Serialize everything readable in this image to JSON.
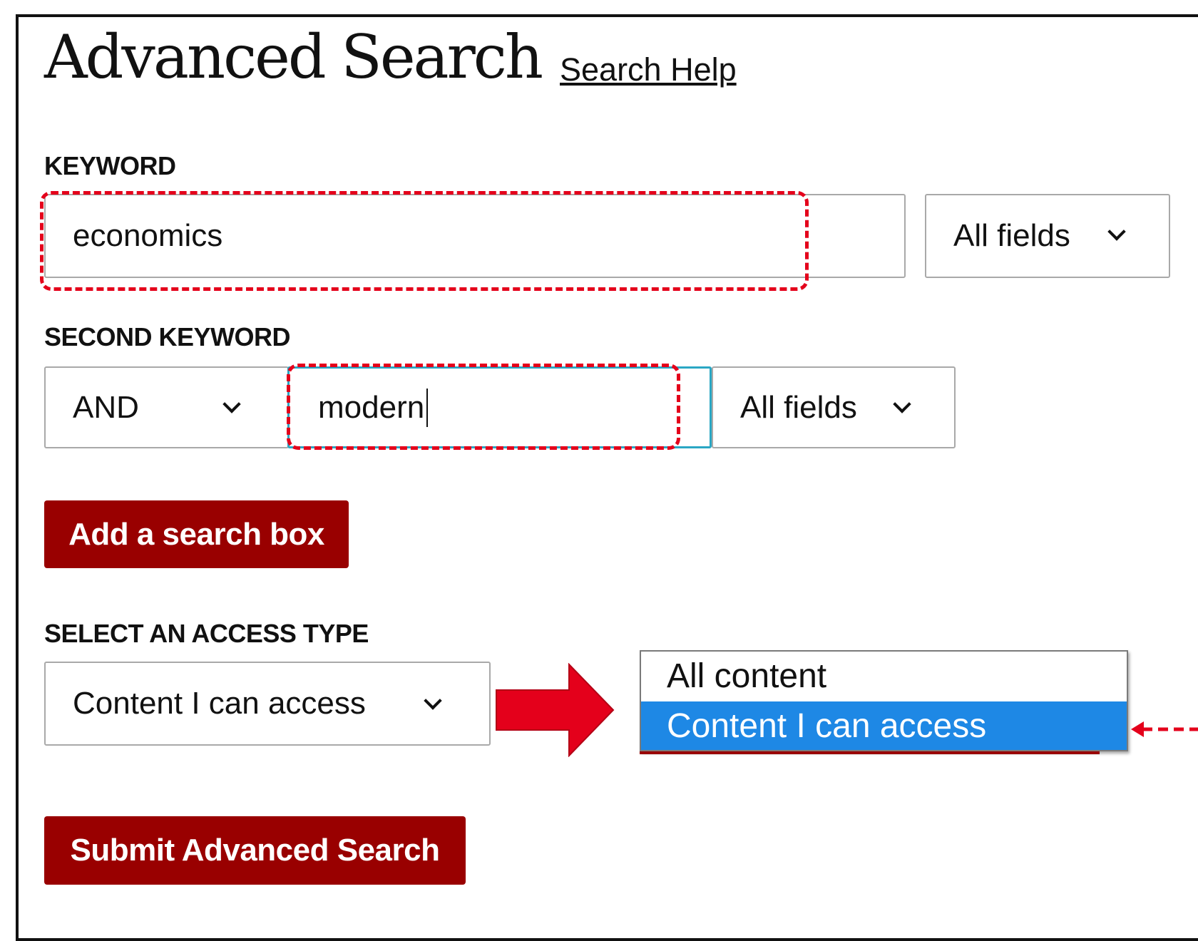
{
  "header": {
    "title": "Advanced Search",
    "help_link": "Search Help"
  },
  "keyword": {
    "label": "KEYWORD",
    "value": "economics",
    "field_select": "All fields"
  },
  "second_keyword": {
    "label": "SECOND KEYWORD",
    "operator": "AND",
    "value": "modern",
    "field_select": "All fields"
  },
  "add_box_button": "Add a search box",
  "access": {
    "label": "SELECT AN ACCESS TYPE",
    "selected": "Content I can access",
    "options": [
      "All content",
      "Content I can access"
    ],
    "highlighted_index": 1
  },
  "submit_button": "Submit Advanced Search",
  "colors": {
    "button_bg": "#990000",
    "annotation_red": "#e4001b",
    "highlight_blue": "#1e88e5"
  },
  "icons": [
    "chevron-down-icon",
    "right-arrow-icon",
    "left-pointer-arrow-icon"
  ]
}
